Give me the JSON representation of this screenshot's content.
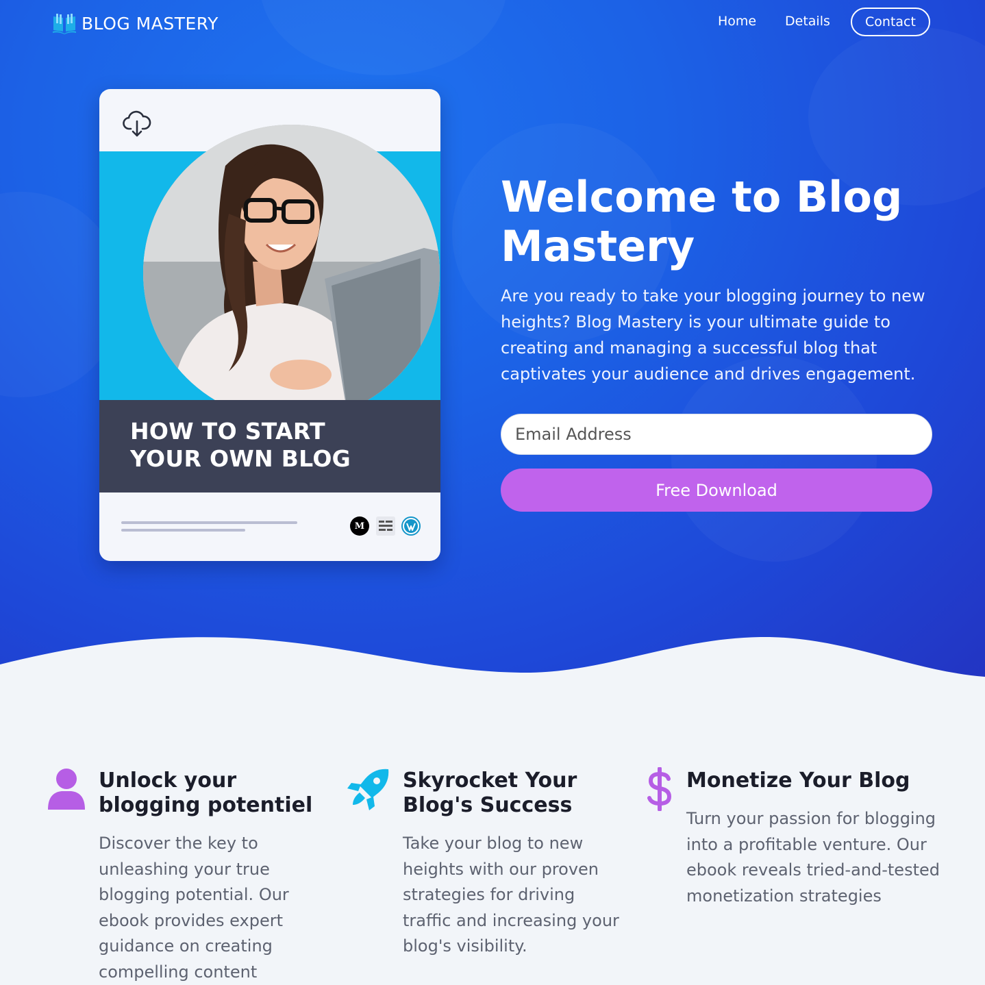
{
  "brand": {
    "name": "BLOG MASTERY"
  },
  "nav": {
    "home": "Home",
    "details": "Details",
    "contact": "Contact"
  },
  "ebook": {
    "title_line1": "HOW TO START",
    "title_line2": "YOUR OWN BLOG",
    "badges": [
      "M"
    ]
  },
  "hero": {
    "headline_line1": "Welcome to Blog",
    "headline_line2": "Mastery",
    "lede": "Are you ready to take your blogging journey to new heights? Blog Mastery is your ultimate guide to creating and managing a successful blog that captivates your audience and drives engagement.",
    "email_placeholder": "Email Address",
    "cta": "Free Download"
  },
  "features": [
    {
      "icon": "user-icon",
      "title": "Unlock your blogging potentiel",
      "body": "Discover the key to unleashing your true blogging potential. Our ebook provides expert guidance on creating compelling content"
    },
    {
      "icon": "rocket-icon",
      "title": "Skyrocket Your Blog's Success",
      "body": "Take your blog to new heights with our proven strategies for driving traffic and increasing your blog's visibility."
    },
    {
      "icon": "dollar-icon",
      "title": "Monetize Your Blog",
      "body": "Turn your passion for blogging into a profitable venture. Our ebook reveals tried-and-tested monetization strategies"
    }
  ],
  "colors": {
    "hero_blue": "#1c62e6",
    "accent_purple": "#c063ec",
    "cyan": "#12b8ea",
    "dark_panel": "#3c4156"
  }
}
